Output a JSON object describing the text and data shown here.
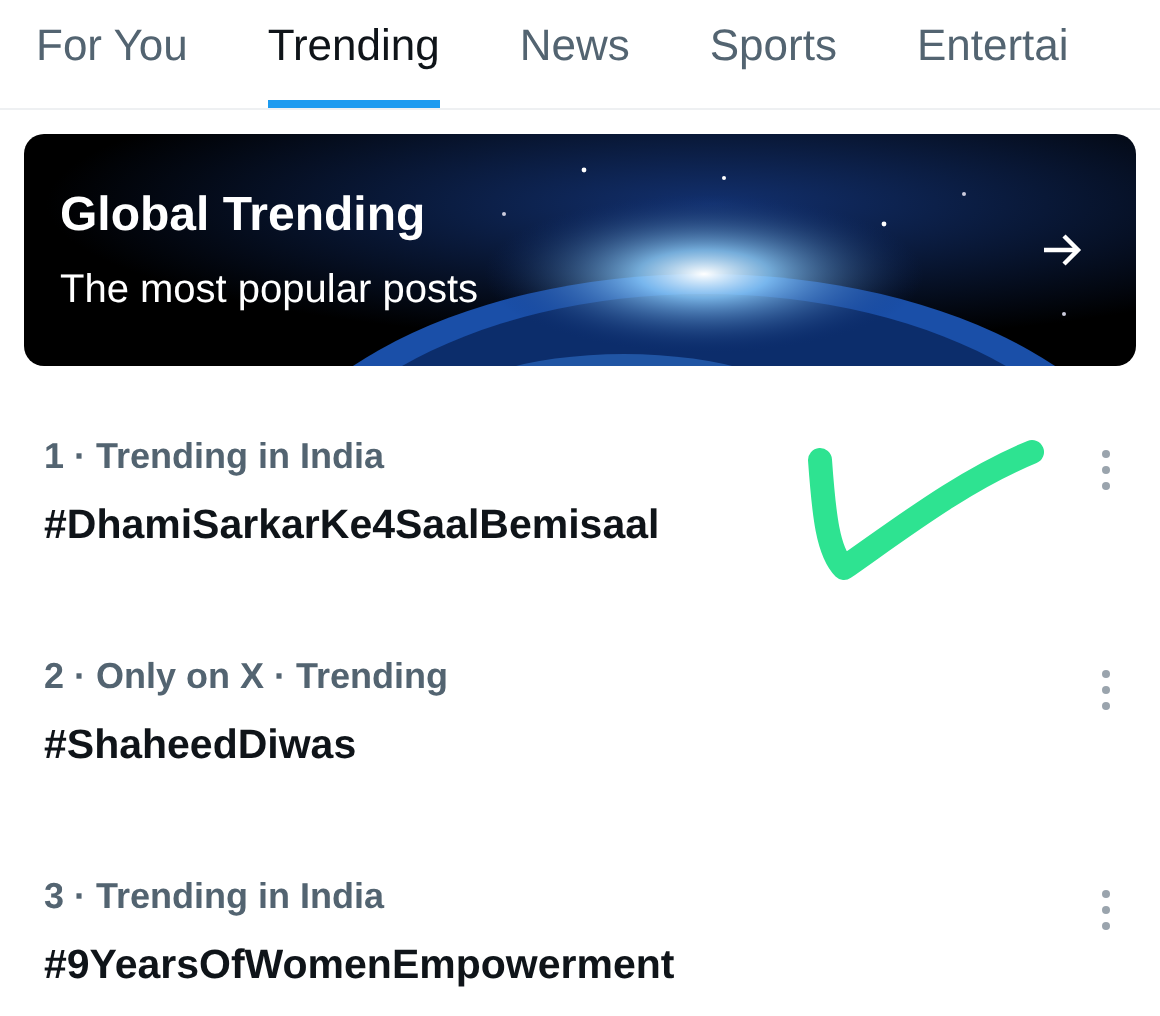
{
  "tabs": [
    {
      "label": "For You",
      "selected": false
    },
    {
      "label": "Trending",
      "selected": true
    },
    {
      "label": "News",
      "selected": false
    },
    {
      "label": "Sports",
      "selected": false
    },
    {
      "label": "Entertai",
      "selected": false
    }
  ],
  "banner": {
    "title": "Global Trending",
    "subtitle": "The most popular posts"
  },
  "trends": [
    {
      "meta": "1 · Trending in India",
      "tag": "#DhamiSarkarKe4SaalBemisaal",
      "checkmarked": true
    },
    {
      "meta": "2 · Only on X · Trending",
      "tag": "#ShaheedDiwas",
      "checkmarked": false
    },
    {
      "meta": "3 · Trending in India",
      "tag": "#9YearsOfWomenEmpowerment",
      "checkmarked": false
    }
  ]
}
